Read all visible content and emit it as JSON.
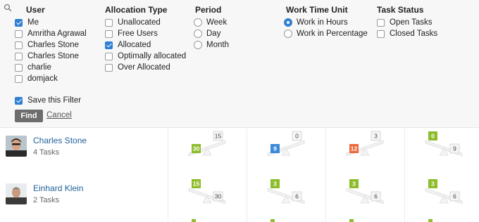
{
  "filters": {
    "user": {
      "title": "User",
      "options": [
        {
          "label": "Me",
          "checked": true
        },
        {
          "label": "Amritha Agrawal",
          "checked": false
        },
        {
          "label": "Charles Stone",
          "checked": false
        },
        {
          "label": "Charles Stone",
          "checked": false
        },
        {
          "label": "charlie",
          "checked": false
        },
        {
          "label": "domjack",
          "checked": false
        }
      ]
    },
    "allocation_type": {
      "title": "Allocation Type",
      "options": [
        {
          "label": "Unallocated",
          "checked": false
        },
        {
          "label": "Free Users",
          "checked": false
        },
        {
          "label": "Allocated",
          "checked": true
        },
        {
          "label": "Optimally allocated",
          "checked": false
        },
        {
          "label": "Over Allocated",
          "checked": false
        }
      ]
    },
    "period": {
      "title": "Period",
      "options": [
        {
          "label": "Week",
          "selected": false
        },
        {
          "label": "Day",
          "selected": false
        },
        {
          "label": "Month",
          "selected": false
        }
      ]
    },
    "work_time_unit": {
      "title": "Work Time Unit",
      "options": [
        {
          "label": "Work in Hours",
          "selected": true
        },
        {
          "label": "Work in Percentage",
          "selected": false
        }
      ]
    },
    "task_status": {
      "title": "Task Status",
      "options": [
        {
          "label": "Open Tasks",
          "checked": false
        },
        {
          "label": "Closed Tasks",
          "checked": false
        }
      ]
    },
    "save_filter": {
      "label": "Save this Filter",
      "checked": true
    },
    "find_label": "Find",
    "cancel_label": "Cancel"
  },
  "colors": {
    "green": "#8dbd2c",
    "blue": "#3b8ad9",
    "orange": "#ec6a3c",
    "link": "#1f5f99",
    "check_blue": "#2f7fd3"
  },
  "people": [
    {
      "name": "Charles Stone",
      "tasks": "4 Tasks",
      "balances": [
        {
          "left": "30",
          "right": "15",
          "color": "green",
          "tilt": "left-down"
        },
        {
          "left": "9",
          "right": "0",
          "color": "blue",
          "tilt": "left-down"
        },
        {
          "left": "12",
          "right": "3",
          "color": "orange",
          "tilt": "left-down"
        },
        {
          "left": "0",
          "right": "9",
          "color": "green",
          "tilt": "right-down"
        }
      ]
    },
    {
      "name": "Einhard Klein",
      "tasks": "2 Tasks",
      "balances": [
        {
          "left": "15",
          "right": "30",
          "color": "green",
          "tilt": "right-down"
        },
        {
          "left": "3",
          "right": "6",
          "color": "green",
          "tilt": "right-down"
        },
        {
          "left": "3",
          "right": "6",
          "color": "green",
          "tilt": "right-down"
        },
        {
          "left": "3",
          "right": "6",
          "color": "green",
          "tilt": "right-down"
        }
      ]
    }
  ]
}
